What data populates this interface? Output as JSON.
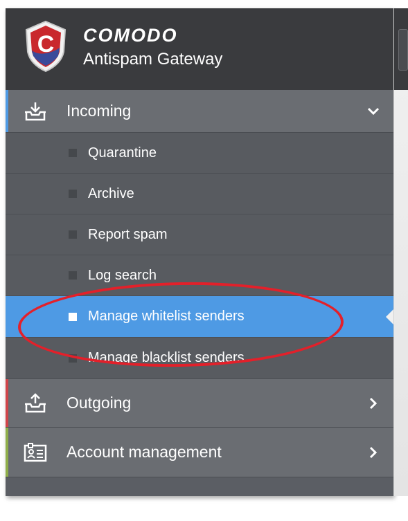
{
  "app": {
    "brand": "COMODO",
    "product": "Antispam Gateway"
  },
  "nav": {
    "incoming": {
      "label": "Incoming",
      "icon": "inbox-icon",
      "expanded": true,
      "items": [
        {
          "label": "Quarantine"
        },
        {
          "label": "Archive"
        },
        {
          "label": "Report spam"
        },
        {
          "label": "Log search"
        },
        {
          "label": "Manage whitelist senders",
          "active": true
        },
        {
          "label": "Manage blacklist senders"
        }
      ]
    },
    "outgoing": {
      "label": "Outgoing",
      "icon": "outbox-icon"
    },
    "account": {
      "label": "Account management",
      "icon": "id-card-icon"
    }
  },
  "colors": {
    "header_bg": "#3a3b3e",
    "section_bg": "#6a6d72",
    "sub_bg": "#585b60",
    "active_bg": "#4e9ae4",
    "incoming_accent": "#4e9ae4",
    "outgoing_accent": "#d0454a",
    "account_accent": "#8fae4a",
    "annotation": "#e3202a"
  }
}
